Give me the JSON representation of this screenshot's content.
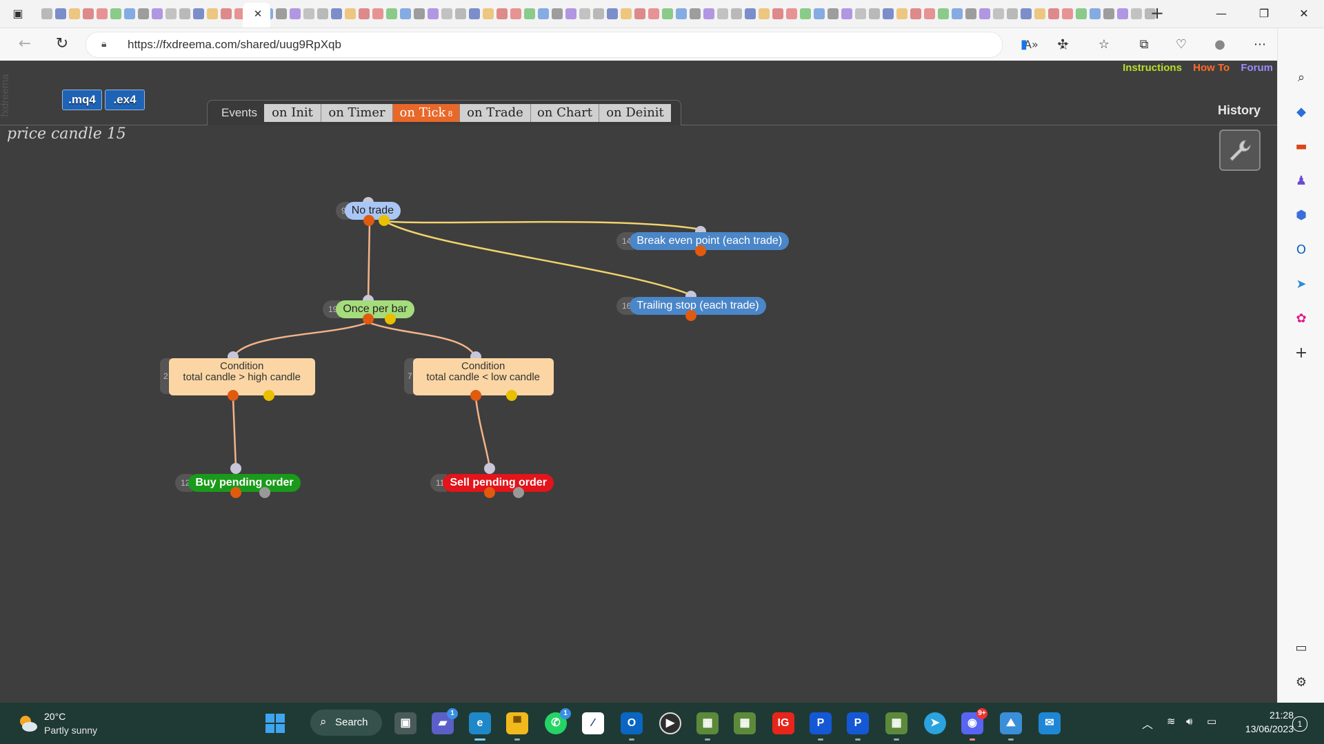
{
  "browser": {
    "url": "https://fxdreema.com/shared/uug9RpXqb",
    "active_tab_close": "✕",
    "new_tab": "+",
    "window_controls": {
      "minimize": "—",
      "restore": "❐",
      "close": "✕"
    }
  },
  "app": {
    "brand_vertical": "fxdreema",
    "buttons": {
      "mq4": ".mq4",
      "ex4": ".ex4"
    },
    "project_title": "price  candle 15",
    "top_links": {
      "instructions": "Instructions",
      "howto": "How To",
      "forum": "Forum",
      "colors": {
        "instructions": "#b8e02a",
        "howto": "#ff6a2a",
        "forum": "#9a8cff"
      }
    },
    "events_label": "Events",
    "event_tabs": [
      {
        "label": "on Init"
      },
      {
        "label": "on Timer"
      },
      {
        "label": "on Tick",
        "badge": "8",
        "active": true
      },
      {
        "label": "on Trade"
      },
      {
        "label": "on Chart"
      },
      {
        "label": "on Deinit"
      }
    ],
    "history_label": "History"
  },
  "blocks": {
    "no_trade": {
      "id": "9",
      "label": "No trade",
      "color": "#a9c6f5"
    },
    "break_even": {
      "id": "14",
      "label": "Break even point (each trade)",
      "color": "#4a86c8"
    },
    "trailing_stop": {
      "id": "16",
      "label": "Trailing stop (each trade)",
      "color": "#4a86c8"
    },
    "once_per_bar": {
      "id": "19",
      "label": "Once per bar",
      "color": "#a5dc7c"
    },
    "cond_high": {
      "id": "2",
      "title": "Condition",
      "text": "total candle > high candle"
    },
    "cond_low": {
      "id": "7",
      "title": "Condition",
      "text": "total candle < low candle"
    },
    "buy_pending": {
      "id": "12",
      "label": "Buy pending order",
      "color": "#1a9a1a"
    },
    "sell_pending": {
      "id": "11",
      "label": "Sell pending order",
      "color": "#e3141a"
    }
  },
  "taskbar": {
    "weather_temp": "20°C",
    "weather_desc": "Partly sunny",
    "search_label": "Search",
    "badges": {
      "teams": "1",
      "whatsapp": "1",
      "discord": "9+"
    },
    "time": "21:28",
    "date": "13/06/2023",
    "notifications": "1"
  }
}
